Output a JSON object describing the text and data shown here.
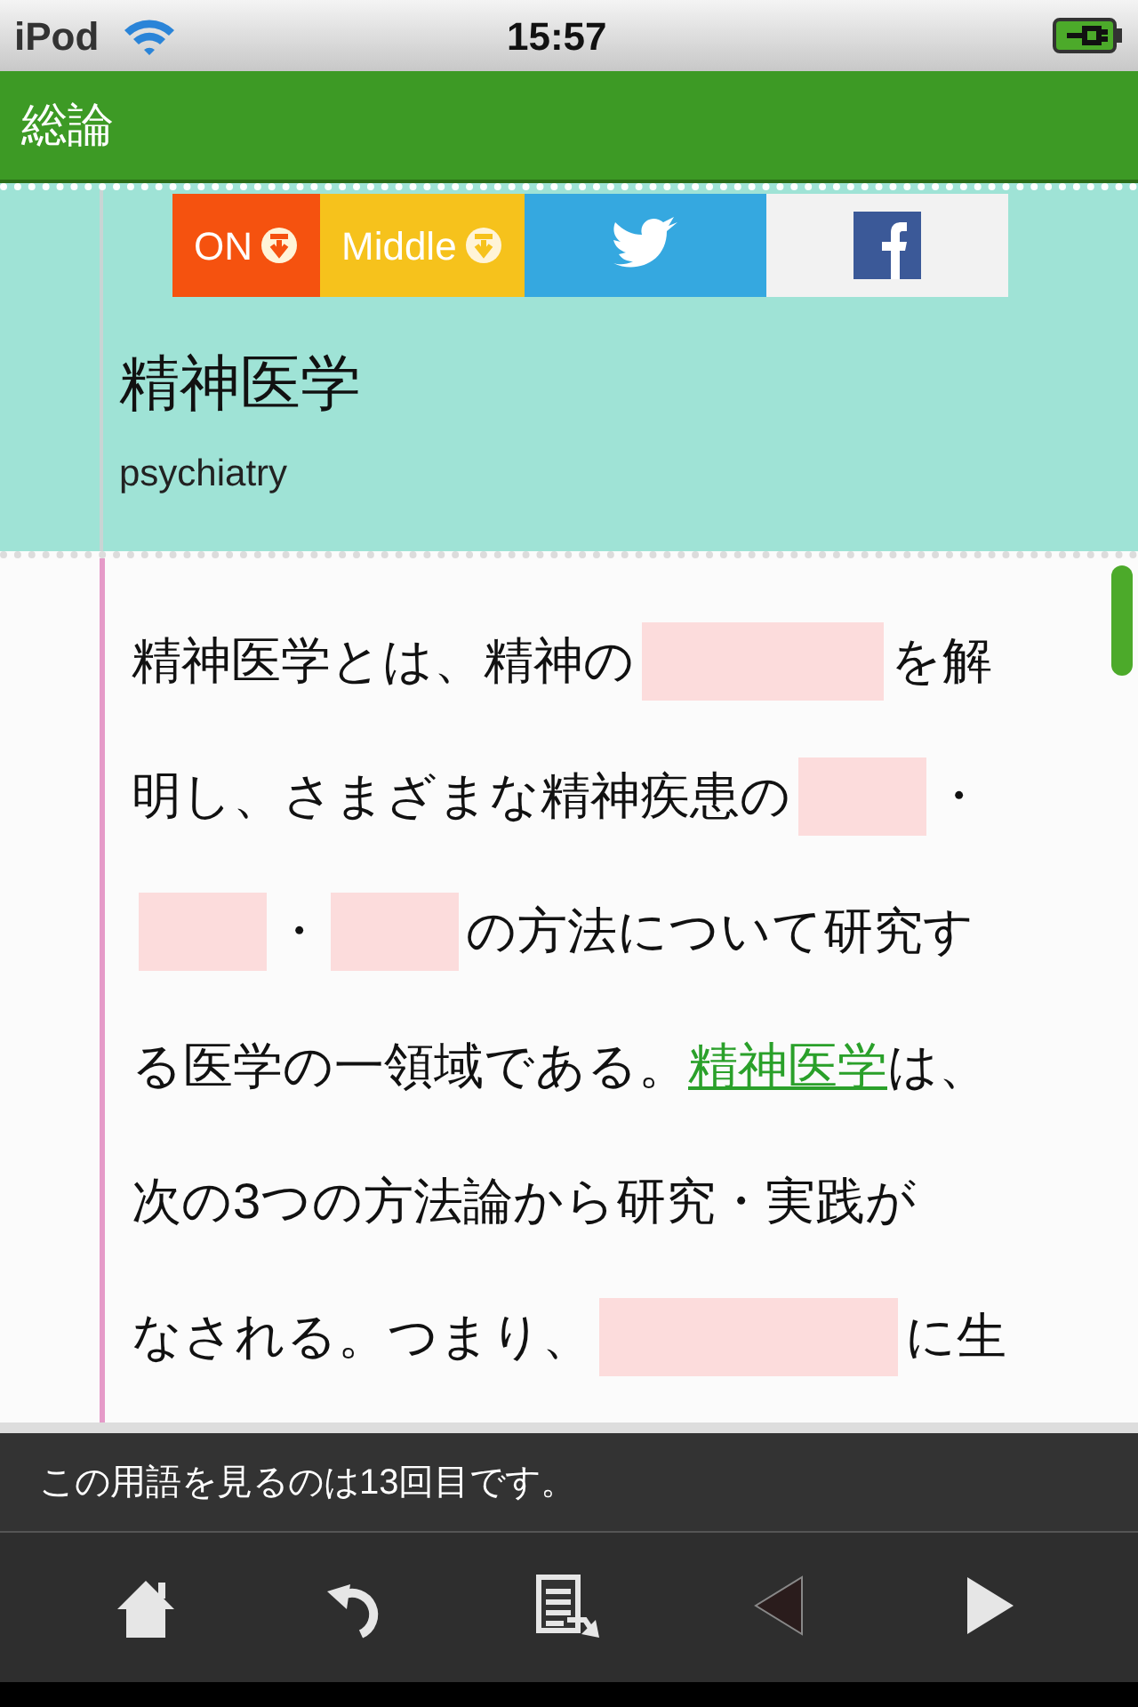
{
  "status_bar": {
    "carrier": "iPod",
    "time": "15:57"
  },
  "header": {
    "title": "総論"
  },
  "mode_tabs": [
    {
      "kind": "mode",
      "label": "ON",
      "color": "#f5520f"
    },
    {
      "kind": "mode",
      "label": "Middle",
      "color": "#f6c21c"
    },
    {
      "kind": "twitter",
      "color": "#35a8e0"
    },
    {
      "kind": "facebook",
      "color": "#f2f2f2"
    }
  ],
  "term": {
    "title": "精神医学",
    "reading": "psychiatry"
  },
  "body_lines": [
    [
      {
        "kind": "text",
        "text": "精神医学とは、精神の"
      },
      {
        "kind": "blank_wide"
      },
      {
        "kind": "text",
        "text": "を解"
      }
    ],
    [
      {
        "kind": "text",
        "text": "明し、さまざまな精神疾患の"
      },
      {
        "kind": "blank"
      },
      {
        "kind": "text",
        "text": "・"
      }
    ],
    [
      {
        "kind": "blank"
      },
      {
        "kind": "text",
        "text": "・"
      },
      {
        "kind": "blank"
      },
      {
        "kind": "text",
        "text": "の方法について研究す"
      }
    ],
    [
      {
        "kind": "text",
        "text": "る医学の一領域である。"
      },
      {
        "kind": "link",
        "text": "精神医学"
      },
      {
        "kind": "text",
        "text": " は、"
      }
    ],
    [
      {
        "kind": "text",
        "text": "次の3つの方法論から研究・実践が"
      }
    ],
    [
      {
        "kind": "text",
        "text": "なされる。つまり、"
      },
      {
        "kind": "blank_xwide"
      },
      {
        "kind": "text",
        "text": "に生"
      }
    ]
  ],
  "message": "この用語を見るのは13回目です。",
  "toolbar": [
    {
      "kind": "home",
      "disabled": false
    },
    {
      "kind": "undo",
      "disabled": false
    },
    {
      "kind": "notes",
      "disabled": false
    },
    {
      "kind": "prev",
      "disabled": true
    },
    {
      "kind": "next",
      "disabled": false
    }
  ]
}
